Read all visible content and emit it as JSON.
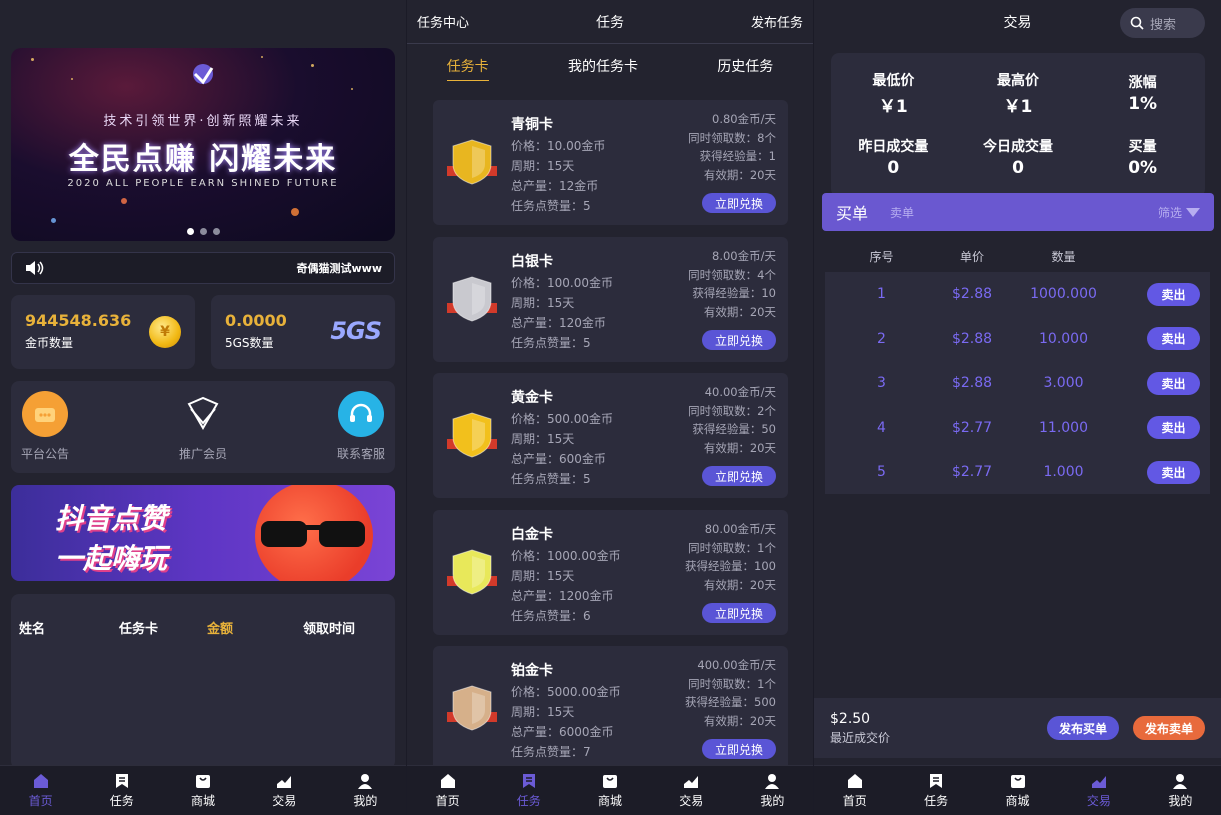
{
  "colors": {
    "accent": "#6a58d0",
    "gold": "#e8b23a",
    "sell_orange": "#e86a3c",
    "bg": "#23232f",
    "card": "#2c2c3c"
  },
  "tabs": [
    "首页",
    "任务",
    "商城",
    "交易",
    "我的"
  ],
  "home": {
    "banner": {
      "subtitle": "技术引领世界·创新照耀未来",
      "title": "全民点赚  闪耀未来",
      "en": "2020 ALL PEOPLE EARN  SHINED FUTURE"
    },
    "notice": "奇偶猫测试www",
    "coins": {
      "value": "944548.636",
      "label": "金币数量"
    },
    "fivegs": {
      "value": "0.0000",
      "label": "5GS数量",
      "logo": "5GS"
    },
    "quick": [
      "平台公告",
      "推广会员",
      "联系客服"
    ],
    "promo": {
      "line1": "抖音点赞",
      "line2": "一起嗨玩"
    },
    "records_header": [
      "姓名",
      "任务卡",
      "金额",
      "领取时间"
    ]
  },
  "task": {
    "header": {
      "left": "任务中心",
      "center": "任务",
      "right": "发布任务"
    },
    "subtabs": [
      "任务卡",
      "我的任务卡",
      "历史任务"
    ],
    "cards": [
      {
        "name": "青铜卡",
        "price": "价格：10.00金币",
        "cycle": "周期：15天",
        "total": "总产量：12金币",
        "points": "任务点赞量：5",
        "rate": "0.80金币/天",
        "daily": "同时领取数：8个",
        "exp": "获得经验量：1",
        "valid": "有效期：20天",
        "btn": "立即兑换",
        "color": "#e8b620"
      },
      {
        "name": "白银卡",
        "price": "价格：100.00金币",
        "cycle": "周期：15天",
        "total": "总产量：120金币",
        "points": "任务点赞量：5",
        "rate": "8.00金币/天",
        "daily": "同时领取数：4个",
        "exp": "获得经验量：10",
        "valid": "有效期：20天",
        "btn": "立即兑换",
        "color": "#c9c9cf"
      },
      {
        "name": "黄金卡",
        "price": "价格：500.00金币",
        "cycle": "周期：15天",
        "total": "总产量：600金币",
        "points": "任务点赞量：5",
        "rate": "40.00金币/天",
        "daily": "同时领取数：2个",
        "exp": "获得经验量：50",
        "valid": "有效期：20天",
        "btn": "立即兑换",
        "color": "#f2c01c"
      },
      {
        "name": "白金卡",
        "price": "价格：1000.00金币",
        "cycle": "周期：15天",
        "total": "总产量：1200金币",
        "points": "任务点赞量：6",
        "rate": "80.00金币/天",
        "daily": "同时领取数：1个",
        "exp": "获得经验量：100",
        "valid": "有效期：20天",
        "btn": "立即兑换",
        "color": "#e8e85a"
      },
      {
        "name": "铂金卡",
        "price": "价格：5000.00金币",
        "cycle": "周期：15天",
        "total": "总产量：6000金币",
        "points": "任务点赞量：7",
        "rate": "400.00金币/天",
        "daily": "同时领取数：1个",
        "exp": "获得经验量：500",
        "valid": "有效期：20天",
        "btn": "立即兑换",
        "color": "#d6b08a"
      }
    ]
  },
  "trade": {
    "title": "交易",
    "search": "搜索",
    "stats": [
      {
        "label": "最低价",
        "value": "￥1"
      },
      {
        "label": "最高价",
        "value": "￥1"
      },
      {
        "label": "涨幅",
        "value": "1%"
      },
      {
        "label": "昨日成交量",
        "value": "0"
      },
      {
        "label": "今日成交量",
        "value": "0"
      },
      {
        "label": "买量",
        "value": "0%"
      }
    ],
    "buy_tab": "买单",
    "sell_tab": "卖单",
    "filter": "筛选",
    "columns": [
      "序号",
      "单价",
      "数量"
    ],
    "rows": [
      {
        "no": "1",
        "price": "$2.88",
        "qty": "1000.000",
        "btn": "卖出"
      },
      {
        "no": "2",
        "price": "$2.88",
        "qty": "10.000",
        "btn": "卖出"
      },
      {
        "no": "3",
        "price": "$2.88",
        "qty": "3.000",
        "btn": "卖出"
      },
      {
        "no": "4",
        "price": "$2.77",
        "qty": "11.000",
        "btn": "卖出"
      },
      {
        "no": "5",
        "price": "$2.77",
        "qty": "1.000",
        "btn": "卖出"
      }
    ],
    "last_price": "$2.50",
    "last_price_label": "最近成交价",
    "post_buy": "发布买单",
    "post_sell": "发布卖单"
  }
}
